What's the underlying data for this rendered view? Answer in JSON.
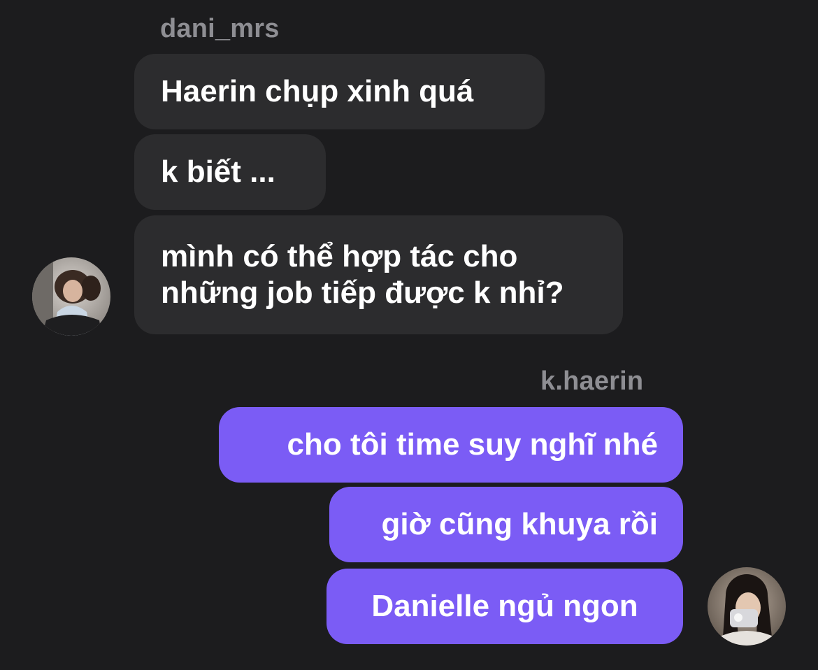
{
  "conversation": {
    "incoming": {
      "sender": "dani_mrs",
      "messages": [
        "Haerin chụp xinh quá",
        "k biết ...",
        "mình có thể hợp tác cho\nnhững job tiếp được k nhỉ?"
      ]
    },
    "outgoing": {
      "sender": "k.haerin",
      "messages": [
        "cho tôi time suy nghĩ nhé",
        "giờ cũng khuya rồi",
        "Danielle ngủ ngon"
      ]
    }
  },
  "colors": {
    "background": "#1c1c1e",
    "incoming_bubble": "#2c2c2e",
    "outgoing_bubble": "#7b5cf5",
    "sender_name": "#8e8e93",
    "message_text": "#ffffff"
  },
  "icons": {
    "incoming_avatar": "avatar-photo-dani",
    "outgoing_avatar": "avatar-photo-haerin"
  }
}
